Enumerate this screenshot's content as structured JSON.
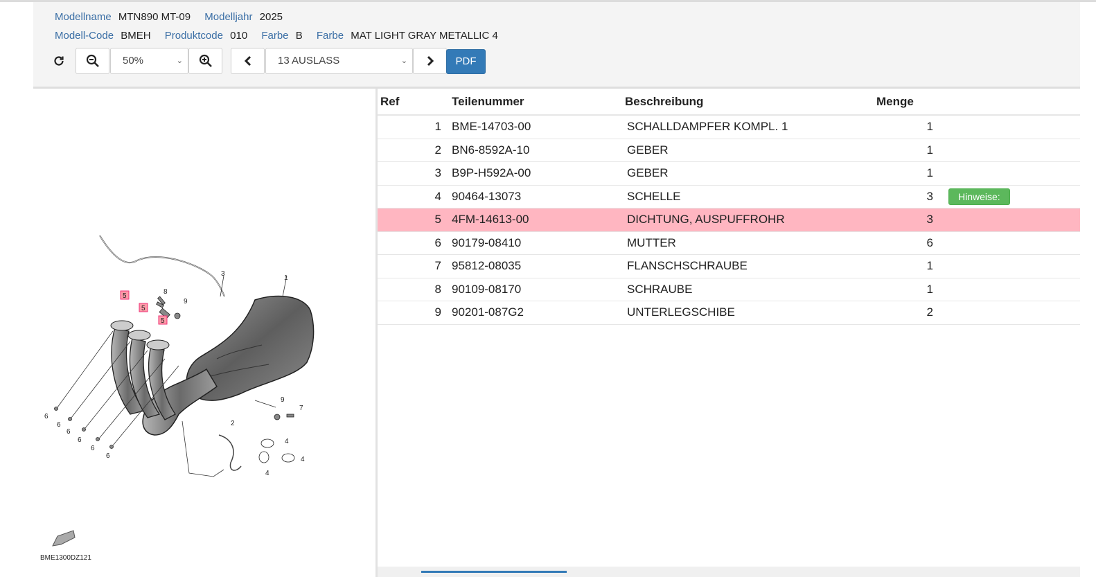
{
  "model": {
    "name_label": "Modellname",
    "name_value": "MTN890 MT-09",
    "year_label": "Modelljahr",
    "year_value": "2025",
    "code_label": "Modell-Code",
    "code_value": "BMEH",
    "product_label": "Produktcode",
    "product_value": "010",
    "color_label": "Farbe",
    "color_value": "B",
    "color2_label": "Farbe",
    "color2_value": "MAT LIGHT GRAY METALLIC 4"
  },
  "toolbar": {
    "zoom_value": "50%",
    "section_value": "13 AUSLASS",
    "pdf_label": "PDF"
  },
  "diagram": {
    "code": "BME1300DZ121",
    "callouts": [
      "1",
      "2",
      "3",
      "4",
      "5",
      "6",
      "7",
      "8",
      "9"
    ]
  },
  "table": {
    "headers": {
      "ref": "Ref",
      "part": "Teilenummer",
      "desc": "Beschreibung",
      "qty": "Menge"
    },
    "rows": [
      {
        "ref": "1",
        "part": "BME-14703-00",
        "desc": "SCHALLDAMPFER KOMPL. 1",
        "qty": "1",
        "note": ""
      },
      {
        "ref": "2",
        "part": "BN6-8592A-10",
        "desc": "GEBER",
        "qty": "1",
        "note": ""
      },
      {
        "ref": "3",
        "part": "B9P-H592A-00",
        "desc": "GEBER",
        "qty": "1",
        "note": ""
      },
      {
        "ref": "4",
        "part": "90464-13073",
        "desc": "SCHELLE",
        "qty": "3",
        "note": "Hinweise:"
      },
      {
        "ref": "5",
        "part": "4FM-14613-00",
        "desc": "DICHTUNG, AUSPUFFROHR",
        "qty": "3",
        "note": ""
      },
      {
        "ref": "6",
        "part": "90179-08410",
        "desc": "MUTTER",
        "qty": "6",
        "note": ""
      },
      {
        "ref": "7",
        "part": "95812-08035",
        "desc": "FLANSCHSCHRAUBE",
        "qty": "1",
        "note": ""
      },
      {
        "ref": "8",
        "part": "90109-08170",
        "desc": "SCHRAUBE",
        "qty": "1",
        "note": ""
      },
      {
        "ref": "9",
        "part": "90201-087G2",
        "desc": "UNTERLEGSCHIBE",
        "qty": "2",
        "note": ""
      }
    ]
  },
  "colors": {
    "label_blue": "#3a6ea5",
    "highlight_row": "#ffb6c1",
    "pdf_button": "#337ab7",
    "badge_green": "#5cb85c"
  }
}
